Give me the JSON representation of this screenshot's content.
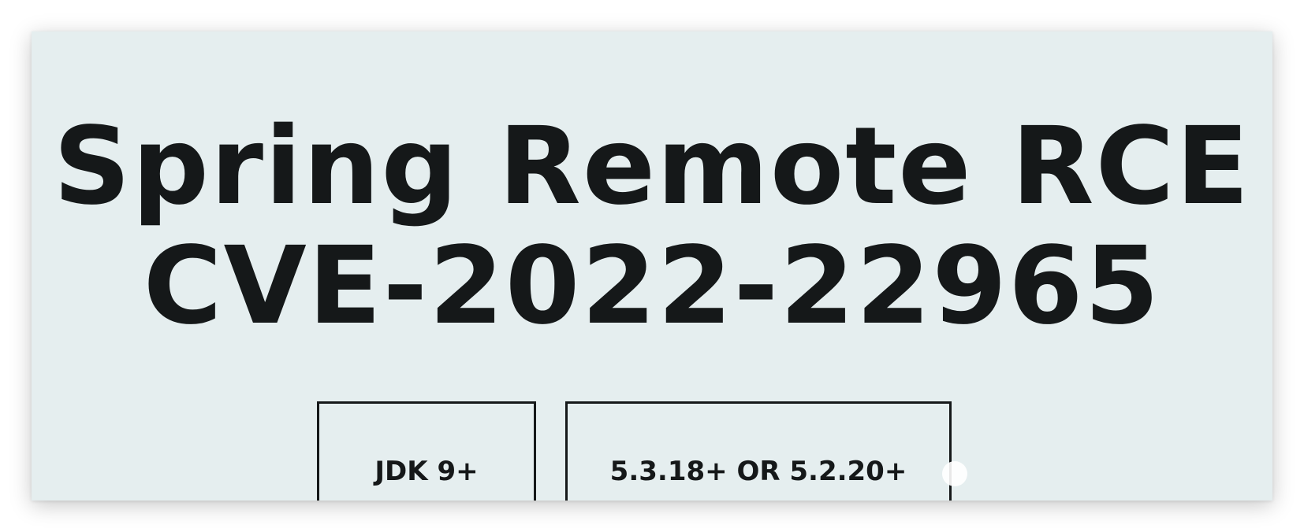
{
  "card": {
    "title_line1": "Spring Remote RCE",
    "title_line2": "CVE-2022-22965"
  },
  "badges": {
    "jdk_label": "JDK 9+",
    "version_label": "5.3.18+ OR 5.2.20+"
  },
  "colors": {
    "card_background": "#e5eeef",
    "text": "#151819",
    "page_background": "#ffffff"
  }
}
